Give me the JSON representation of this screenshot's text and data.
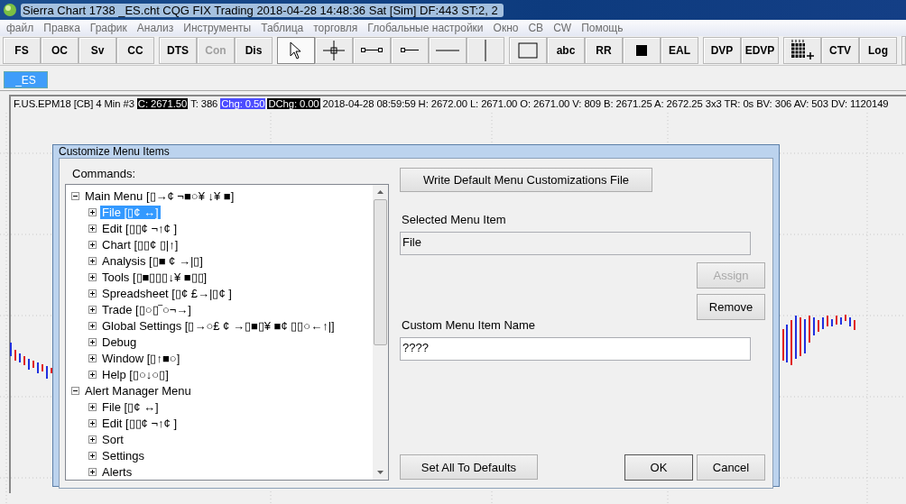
{
  "window": {
    "title": "Sierra Chart 1738 _ES.cht  CQG FIX Trading 2018-04-28  14:48:36 Sat [Sim]  DF:443  ST:2, 2"
  },
  "menu": [
    "файл",
    "Правка",
    "График",
    "Анализ",
    "Инструменты",
    "Таблица",
    "торговля",
    "Глобальные настройки",
    "Окно",
    "CB",
    "CW",
    "Помощь"
  ],
  "toolbar": {
    "groups": [
      [
        {
          "kind": "text",
          "label": "FS",
          "selected": false,
          "disabled": false
        },
        {
          "kind": "text",
          "label": "OC",
          "selected": false,
          "disabled": false
        },
        {
          "kind": "text",
          "label": "Sv",
          "selected": false,
          "disabled": false
        },
        {
          "kind": "text",
          "label": "CC",
          "selected": false,
          "disabled": false
        }
      ],
      [
        {
          "kind": "text",
          "label": "DTS",
          "selected": false,
          "disabled": false
        },
        {
          "kind": "text",
          "label": "Con",
          "selected": false,
          "disabled": true
        },
        {
          "kind": "text",
          "label": "Dis",
          "selected": false,
          "disabled": false
        }
      ],
      [
        {
          "kind": "cursor",
          "selected": true,
          "disabled": false
        },
        {
          "kind": "crosshair",
          "selected": false,
          "disabled": false
        },
        {
          "kind": "segment",
          "selected": false,
          "disabled": false
        },
        {
          "kind": "ray",
          "selected": false,
          "disabled": false
        },
        {
          "kind": "hline",
          "selected": false,
          "disabled": false
        },
        {
          "kind": "vline",
          "selected": false,
          "disabled": false
        }
      ],
      [
        {
          "kind": "rect",
          "selected": false,
          "disabled": false
        },
        {
          "kind": "text",
          "label": "abc",
          "selected": false,
          "disabled": false
        },
        {
          "kind": "text",
          "label": "RR",
          "selected": false,
          "disabled": false
        },
        {
          "kind": "square",
          "selected": false,
          "disabled": false
        },
        {
          "kind": "text",
          "label": "EAL",
          "selected": false,
          "disabled": false
        }
      ],
      [
        {
          "kind": "text",
          "label": "DVP",
          "selected": false,
          "disabled": false
        },
        {
          "kind": "text",
          "label": "EDVP",
          "selected": false,
          "disabled": false
        }
      ],
      [
        {
          "kind": "grid",
          "selected": false,
          "disabled": false
        },
        {
          "kind": "text",
          "label": "CTV",
          "selected": false,
          "disabled": false
        },
        {
          "kind": "text",
          "label": "Log",
          "selected": false,
          "disabled": false
        }
      ]
    ]
  },
  "tabs": [
    {
      "label": "_ES",
      "selected": true
    }
  ],
  "info_line": [
    {
      "text": "F.US.EPM18 [CB]  4 Min   #3",
      "kind": "plain"
    },
    {
      "text": "C: 2671.50",
      "kind": "inverse"
    },
    {
      "text": "T: 386",
      "kind": "plain"
    },
    {
      "text": "Chg: 0.50",
      "kind": "blue"
    },
    {
      "text": "DChg: 0.00",
      "kind": "inverse"
    },
    {
      "text": "2018-04-28 08:59:59 H: 2672.00 L: 2671.00 O: 2671.00 V: 809 B: 2671.25 A: 2672.25 3x3 TR: 0s BV: 306 AV: 503 DV: 1120149",
      "kind": "plain"
    }
  ],
  "dialog": {
    "title": "Customize Menu Items",
    "commands_label": "Commands:",
    "tree": [
      {
        "label": "Main Menu [▯→¢ ¬■○¥ ↓¥ ■]",
        "expanded": true,
        "selected": false,
        "children": [
          {
            "label": "File [▯¢ ↔]",
            "expanded": false,
            "selected": true
          },
          {
            "label": "Edit [▯▯¢ ¬↑¢ ]",
            "expanded": false,
            "selected": false
          },
          {
            "label": "Chart [▯▯¢ ▯|↑]",
            "expanded": false,
            "selected": false
          },
          {
            "label": "Analysis [▯■ ¢ →|▯]",
            "expanded": false,
            "selected": false
          },
          {
            "label": "Tools [▯■▯▯▯↓¥ ■▯▯]",
            "expanded": false,
            "selected": false
          },
          {
            "label": "Spreadsheet [▯¢ £→|▯¢ ]",
            "expanded": false,
            "selected": false
          },
          {
            "label": "Trade [▯○▯‾○¬→]",
            "expanded": false,
            "selected": false
          },
          {
            "label": "Global Settings [▯→○£ ¢ →▯■▯¥ ■¢ ▯▯○←↑|]",
            "expanded": false,
            "selected": false
          },
          {
            "label": "Debug",
            "expanded": false,
            "selected": false
          },
          {
            "label": "Window [▯↑■○]",
            "expanded": false,
            "selected": false
          },
          {
            "label": "Help [▯○↓○▯]",
            "expanded": false,
            "selected": false
          }
        ]
      },
      {
        "label": "Alert Manager Menu",
        "expanded": true,
        "selected": false,
        "children": [
          {
            "label": "File [▯¢ ↔]",
            "expanded": false,
            "selected": false
          },
          {
            "label": "Edit [▯▯¢ ¬↑¢ ]",
            "expanded": false,
            "selected": false
          },
          {
            "label": "Sort",
            "expanded": false,
            "selected": false
          },
          {
            "label": "Settings",
            "expanded": false,
            "selected": false
          },
          {
            "label": "Alerts",
            "expanded": false,
            "selected": false
          }
        ]
      }
    ],
    "write_defaults_button": "Write Default Menu Customizations File",
    "selected_item_label": "Selected Menu Item",
    "selected_item_value": "File",
    "assign_button": {
      "label": "Assign",
      "disabled": true
    },
    "remove_button": {
      "label": "Remove",
      "disabled": false
    },
    "custom_name_label": "Custom Menu Item Name",
    "custom_name_value": "????",
    "set_defaults_button": "Set All To Defaults",
    "ok_button": "OK",
    "cancel_button": "Cancel"
  }
}
